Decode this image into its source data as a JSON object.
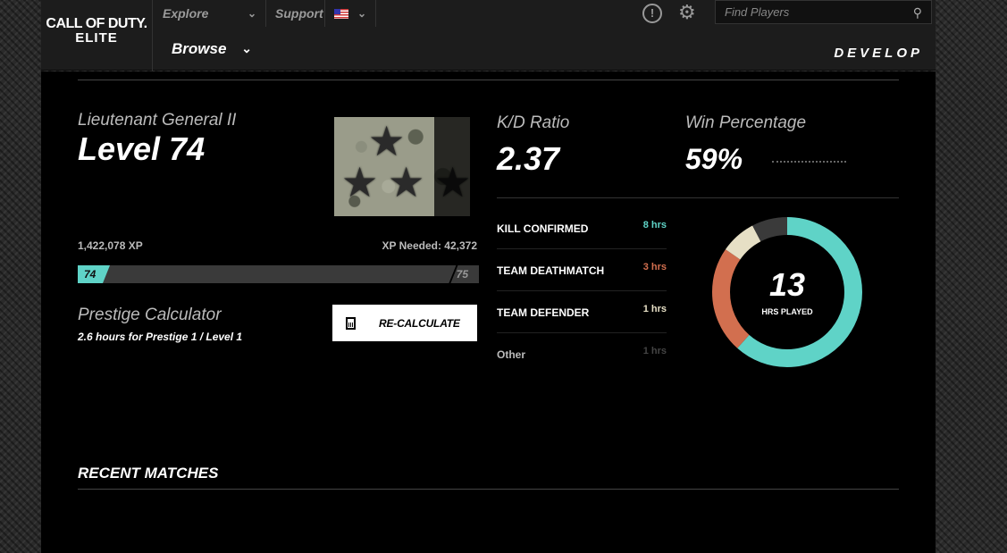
{
  "header": {
    "logo_line1": "CALL OF DUTY.",
    "logo_line2": "ELITE",
    "nav": {
      "explore": "Explore",
      "support": "Support"
    },
    "browse": "Browse",
    "search_placeholder": "Find Players",
    "section": "DEVELOP"
  },
  "profile": {
    "rank_name": "Lieutenant General II",
    "level": "Level 74",
    "xp_total": "1,422,078 XP",
    "xp_needed": "XP Needed: 42,372",
    "current_level": "74",
    "next_level": "75"
  },
  "prestige": {
    "title": "Prestige Calculator",
    "subtitle": "2.6 hours for Prestige 1 / Level 1",
    "button": "RE-CALCULATE"
  },
  "stats": {
    "kd_title": "K/D Ratio",
    "kd_value": "2.37",
    "win_title": "Win Percentage",
    "win_value": "59%"
  },
  "modes": [
    {
      "name": "KILL CONFIRMED",
      "hours": "8 hrs",
      "color": "#5fd3c7"
    },
    {
      "name": "TEAM DEATHMATCH",
      "hours": "3 hrs",
      "color": "#d26f4f"
    },
    {
      "name": "TEAM DEFENDER",
      "hours": "1 hrs",
      "color": "#e6dfc5"
    },
    {
      "name": "Other",
      "hours": "1 hrs",
      "color": "#444444"
    }
  ],
  "hours_played": {
    "value": "13",
    "label": "HRS PLAYED"
  },
  "recent_matches": "RECENT MATCHES",
  "chart_data": {
    "type": "pie",
    "categories": [
      "KILL CONFIRMED",
      "TEAM DEATHMATCH",
      "TEAM DEFENDER",
      "Other"
    ],
    "values": [
      8,
      3,
      1,
      1
    ],
    "colors": [
      "#5fd3c7",
      "#d26f4f",
      "#e6dfc5",
      "#3a3a3a"
    ]
  }
}
